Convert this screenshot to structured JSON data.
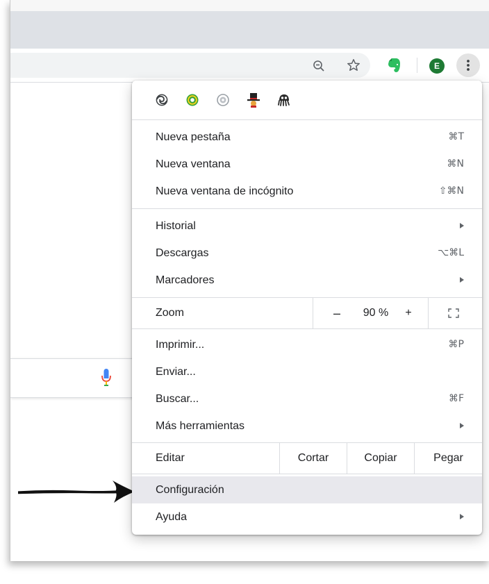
{
  "menu": {
    "extensions": [
      {
        "icon": "sync-loop-icon"
      },
      {
        "icon": "green-ring-extension-icon"
      },
      {
        "icon": "grey-circle-extension-icon"
      },
      {
        "icon": "top-hat-extension-icon"
      },
      {
        "icon": "octopus-extension-icon"
      }
    ],
    "group1": [
      {
        "label": "Nueva pestaña",
        "shortcut": "⌘T"
      },
      {
        "label": "Nueva ventana",
        "shortcut": "⌘N"
      },
      {
        "label": "Nueva ventana de incógnito",
        "shortcut": "⇧⌘N"
      }
    ],
    "group2": [
      {
        "label": "Historial",
        "submenu": true
      },
      {
        "label": "Descargas",
        "shortcut": "⌥⌘L"
      },
      {
        "label": "Marcadores",
        "submenu": true
      }
    ],
    "zoom": {
      "label": "Zoom",
      "minus": "–",
      "value": "90 %",
      "plus": "+"
    },
    "group3": [
      {
        "label": "Imprimir...",
        "shortcut": "⌘P"
      },
      {
        "label": "Enviar..."
      },
      {
        "label": "Buscar...",
        "shortcut": "⌘F"
      },
      {
        "label": "Más herramientas",
        "submenu": true
      }
    ],
    "edit": {
      "label": "Editar",
      "cut": "Cortar",
      "copy": "Copiar",
      "paste": "Pegar"
    },
    "group4": [
      {
        "label": "Configuración",
        "highlighted": true
      },
      {
        "label": "Ayuda",
        "submenu": true
      }
    ]
  },
  "toolbar": {
    "avatar_letter": "E",
    "icons": [
      "zoom-out-icon",
      "star-icon",
      "evernote-icon",
      "more-vert-icon"
    ]
  },
  "colors": {
    "menu_highlight": "#e8e8ed",
    "avatar": "#1e7a34",
    "tabstrip": "#dee1e6",
    "evernote": "#2dbe60"
  }
}
